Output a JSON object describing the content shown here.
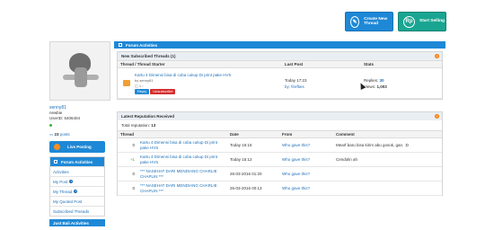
{
  "actions": {
    "create_thread": "Create New Thread",
    "start_selling": "Start Selling"
  },
  "profile": {
    "username": "senny81",
    "rank": "newbie",
    "user_id": "UserID: 6406404",
    "posts_count": "23",
    "posts_label": "posts"
  },
  "live_posting": "Live Posting",
  "sidebar": {
    "header": "Forum Activities",
    "items": [
      {
        "label": "Activities"
      },
      {
        "label": "My Post"
      },
      {
        "label": "My Thread"
      },
      {
        "label": "My Quoted Post"
      },
      {
        "label": "Subscribed Threads"
      }
    ],
    "footer_header": "Just Bali Activities"
  },
  "main": {
    "title": "Forum Activities",
    "subscribed": {
      "header": "New Subscribed Threads (1)",
      "columns": [
        "Thread / Thread Starter",
        "Last Post",
        "Stats"
      ],
      "row": {
        "title": "Kartu 4 Dimensi bisa di coba cukup Di print pake HVS",
        "starter": "by senny81",
        "last_time": "Today 17:23",
        "last_by": "by: firefties",
        "replies_label": "Replies:",
        "replies": "30",
        "views_label": "Views:",
        "views": "1,003",
        "reply_btn": "Reply",
        "unsub_btn": "Unsubscribe"
      }
    },
    "reputation": {
      "header": "Latest Reputation Received",
      "total_label": "Total reputation:",
      "total": "13",
      "columns": [
        "Thread",
        "Date",
        "From",
        "Comment"
      ],
      "rows": [
        {
          "score": "0",
          "thread": "Kartu 4 Dimensi bisa di coba cukup Di print pake HVS",
          "date": "Today 16:16",
          "from": "Who gave this?",
          "comment": "Mearf baru bisa kirim abu gosok, gan. :D"
        },
        {
          "score": "+1",
          "thread": "Kartu 4 Dimensi bisa di coba cukup Di print pake HVS",
          "date": "Today 15:12",
          "from": "Who gave this?",
          "comment": "Cendolin ah"
        },
        {
          "score": "0",
          "thread": "*** NASEHAT DARI MENDIANG CHARLIE CHAPLIN ***",
          "date": "26-03-2016 01:20",
          "from": "Who gave this?",
          "comment": ""
        },
        {
          "score": "0",
          "thread": "*** NASEHAT DARI MENDIANG CHARLIE CHAPLIN ***",
          "date": "26-03-2016 00:13",
          "from": "Who gave this?",
          "comment": ""
        }
      ]
    }
  }
}
